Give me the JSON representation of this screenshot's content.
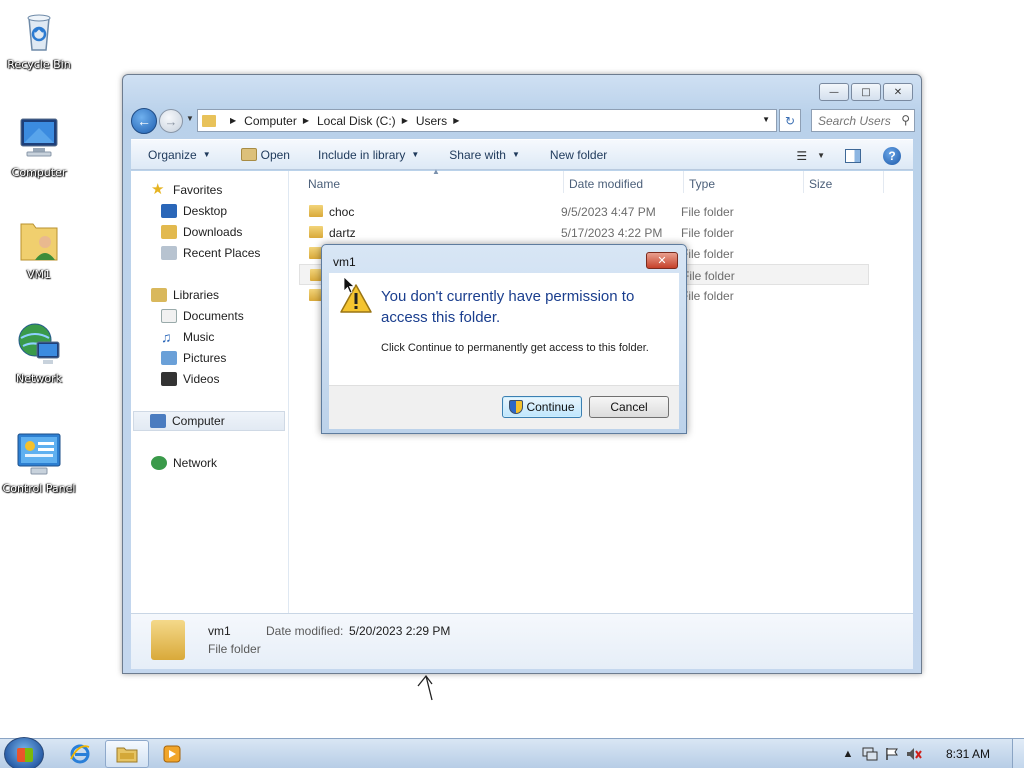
{
  "desktop": {
    "icons": [
      {
        "label": "Recycle Bin",
        "icon": "recycle-bin-icon"
      },
      {
        "label": "Computer",
        "icon": "computer-icon"
      },
      {
        "label": "VM1",
        "icon": "user-folder-icon"
      },
      {
        "label": "Network",
        "icon": "network-icon"
      },
      {
        "label": "Control Panel",
        "icon": "control-panel-icon"
      }
    ]
  },
  "window": {
    "controls": {
      "minimize": "—",
      "maximize": "□",
      "close": "✕"
    },
    "address": {
      "crumbs": [
        "Computer",
        "Local Disk (C:)",
        "Users"
      ]
    },
    "search": {
      "placeholder": "Search Users"
    },
    "toolbar": {
      "organize": "Organize",
      "open": "Open",
      "include": "Include in library",
      "share": "Share with",
      "new_folder": "New folder"
    },
    "nav": {
      "favorites": "Favorites",
      "desktop": "Desktop",
      "downloads": "Downloads",
      "recent": "Recent Places",
      "libraries": "Libraries",
      "documents": "Documents",
      "music": "Music",
      "pictures": "Pictures",
      "videos": "Videos",
      "computer": "Computer",
      "network": "Network"
    },
    "columns": {
      "name": "Name",
      "date": "Date modified",
      "type": "Type",
      "size": "Size"
    },
    "files": [
      {
        "name": "choc",
        "date": "9/5/2023 4:47 PM",
        "type": "File folder"
      },
      {
        "name": "dartz",
        "date": "5/17/2023 4:22 PM",
        "type": "File folder"
      },
      {
        "name": "",
        "date": "",
        "type": "File folder"
      },
      {
        "name": "",
        "date": "",
        "type": "File folder"
      },
      {
        "name": "",
        "date": "",
        "type": "File folder"
      }
    ],
    "details": {
      "name": "vm1",
      "type": "File folder",
      "date_label": "Date modified:",
      "date_value": "5/20/2023 2:29 PM"
    }
  },
  "dialog": {
    "title": "vm1",
    "close": "✕",
    "main": "You don't currently have permission to access this folder.",
    "sub": "Click Continue to permanently get access to this folder.",
    "continue": "Continue",
    "cancel": "Cancel"
  },
  "taskbar": {
    "apps": [
      "internet-explorer-icon",
      "windows-explorer-icon",
      "media-player-icon"
    ],
    "clock": "8:31 AM"
  }
}
